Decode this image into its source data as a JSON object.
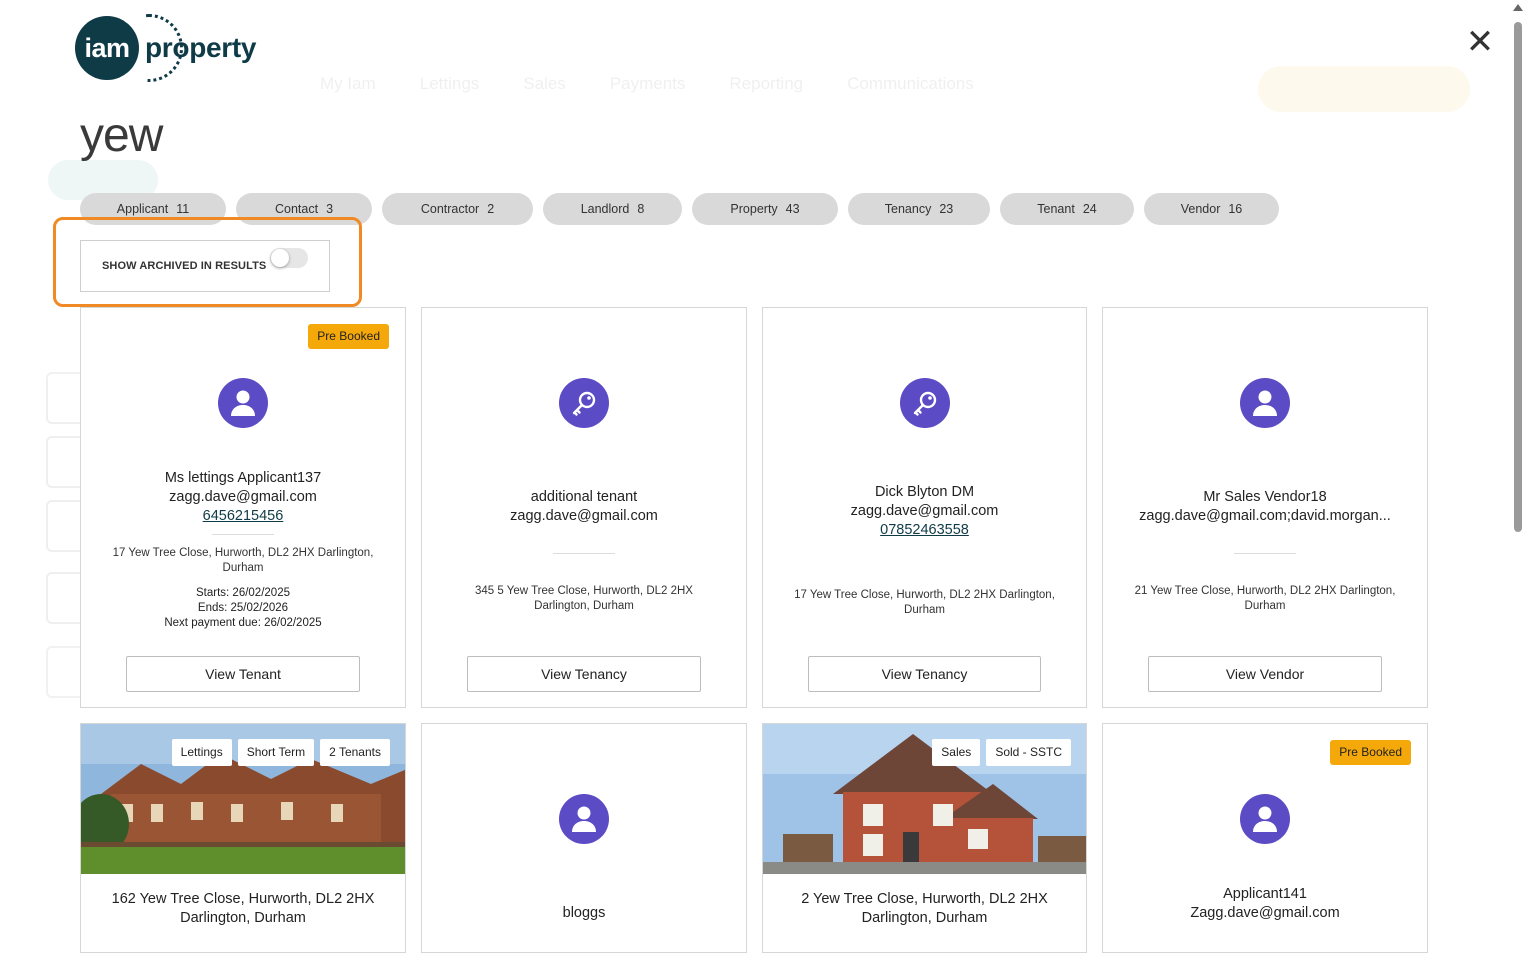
{
  "search": {
    "query": "yew"
  },
  "brand": {
    "logo_mark": "iam",
    "logo_word": "property"
  },
  "background": {
    "nav": [
      "My Iam",
      "Lettings",
      "Sales",
      "Payments",
      "Reporting",
      "Communications"
    ]
  },
  "filters": [
    {
      "label": "Applicant",
      "count": "11"
    },
    {
      "label": "Contact",
      "count": "3"
    },
    {
      "label": "Contractor",
      "count": "2"
    },
    {
      "label": "Landlord",
      "count": "8"
    },
    {
      "label": "Property",
      "count": "43"
    },
    {
      "label": "Tenancy",
      "count": "23"
    },
    {
      "label": "Tenant",
      "count": "24"
    },
    {
      "label": "Vendor",
      "count": "16"
    }
  ],
  "archived_toggle": {
    "label": "SHOW ARCHIVED IN RESULTS",
    "state": "off"
  },
  "cards": [
    {
      "badge": "Pre Booked",
      "icon": "person-icon",
      "name": "Ms lettings Applicant137",
      "email": "zagg.dave@gmail.com",
      "phone": "6456215456",
      "address": "17 Yew Tree Close, Hurworth, DL2 2HX Darlington, Durham",
      "starts": "Starts: 26/02/2025",
      "ends": "Ends: 25/02/2026",
      "next_payment": "Next payment due: 26/02/2025",
      "button": "View Tenant"
    },
    {
      "icon": "key-icon",
      "name": "additional tenant",
      "email": "zagg.dave@gmail.com",
      "address": "345 5 Yew Tree Close, Hurworth, DL2 2HX Darlington, Durham",
      "button": "View Tenancy"
    },
    {
      "icon": "key-icon",
      "name": "Dick Blyton DM",
      "email": "zagg.dave@gmail.com",
      "phone": "07852463558",
      "address": "17 Yew Tree Close, Hurworth, DL2 2HX Darlington, Durham",
      "button": "View Tenancy"
    },
    {
      "icon": "person-icon",
      "name": "Mr Sales Vendor18",
      "email": "zagg.dave@gmail.com;david.morgan...",
      "address": "21 Yew Tree Close, Hurworth, DL2 2HX Darlington, Durham",
      "button": "View Vendor"
    }
  ],
  "row2": [
    {
      "tags": [
        "Lettings",
        "Short Term",
        "2 Tenants"
      ],
      "title": "162 Yew Tree Close, Hurworth, DL2 2HX Darlington, Durham"
    },
    {
      "icon": "person-icon",
      "name": "bloggs"
    },
    {
      "tags": [
        "Sales",
        "Sold - SSTC"
      ],
      "title": "2 Yew Tree Close, Hurworth, DL2 2HX Darlington, Durham"
    },
    {
      "badge": "Pre Booked",
      "icon": "person-icon",
      "name": "Applicant141",
      "email": "Zagg.dave@gmail.com"
    }
  ],
  "colors": {
    "brand": "#0f3b47",
    "avatar": "#5b4bc4",
    "badge": "#f5a80a",
    "highlight": "#f08a24",
    "chip": "#d9d9d9"
  }
}
